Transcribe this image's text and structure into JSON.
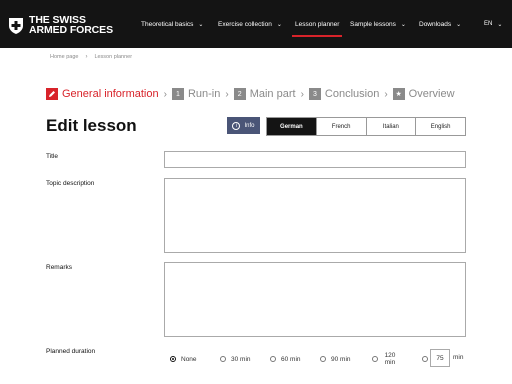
{
  "brand": {
    "line1": "THE SWISS",
    "line2": "ARMED FORCES"
  },
  "nav": [
    {
      "label": "Theoretical basics",
      "has_menu": true,
      "active": false
    },
    {
      "label": "Exercise collection",
      "has_menu": true,
      "active": false
    },
    {
      "label": "Lesson planner",
      "has_menu": false,
      "active": true
    },
    {
      "label": "Sample lessons",
      "has_menu": true,
      "active": false
    },
    {
      "label": "Downloads",
      "has_menu": true,
      "active": false
    }
  ],
  "language": "EN",
  "breadcrumb": [
    "Home page",
    "Lesson planner"
  ],
  "steps": [
    {
      "num": "",
      "label": "General information",
      "active": true,
      "icon": "pencil-icon"
    },
    {
      "num": "1",
      "label": "Run-in",
      "active": false
    },
    {
      "num": "2",
      "label": "Main part",
      "active": false
    },
    {
      "num": "3",
      "label": "Conclusion",
      "active": false
    },
    {
      "num": "★",
      "label": "Overview",
      "active": false,
      "icon": "star-icon"
    }
  ],
  "page_title": "Edit lesson",
  "info_button": "Info",
  "language_tabs": [
    {
      "label": "German",
      "active": true
    },
    {
      "label": "French",
      "active": false
    },
    {
      "label": "Italian",
      "active": false
    },
    {
      "label": "English",
      "active": false
    }
  ],
  "form": {
    "title_label": "Title",
    "title_value": "",
    "topic_label": "Topic description",
    "topic_value": "",
    "remarks_label": "Remarks",
    "remarks_value": "",
    "duration_label": "Planned duration",
    "duration_options": [
      "None",
      "30 min",
      "60 min",
      "90 min",
      "120 min"
    ],
    "duration_selected": "None",
    "custom_minutes": "75",
    "custom_unit": "min"
  },
  "colors": {
    "accent": "#d8232a",
    "header_bg": "#141414",
    "info_bg": "#4a5577",
    "muted": "#8a8a8a"
  }
}
